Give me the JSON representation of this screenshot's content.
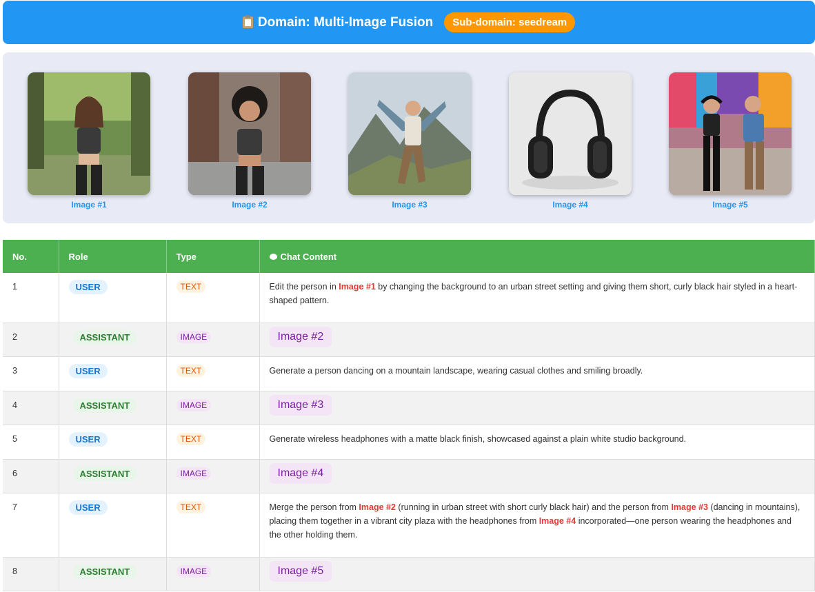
{
  "header": {
    "title": "Domain: Multi-Image Fusion",
    "subdomain": "Sub-domain: seedream"
  },
  "gallery": [
    {
      "label": "Image #1",
      "icon": "photo-woman-running-park"
    },
    {
      "label": "Image #2",
      "icon": "photo-woman-running-street"
    },
    {
      "label": "Image #3",
      "icon": "photo-man-dancing-mountains"
    },
    {
      "label": "Image #4",
      "icon": "photo-headphones"
    },
    {
      "label": "Image #5",
      "icon": "photo-city-plaza-fusion"
    }
  ],
  "table": {
    "headers": [
      "No.",
      "Role",
      "Type",
      "Chat Content"
    ],
    "rows": [
      {
        "no": "1",
        "role": "USER",
        "type": "TEXT",
        "parts": [
          "Edit the person in ",
          "Image #1",
          " by changing the background to an urban street setting and giving them short, curly black hair styled in a heart-shaped pattern."
        ]
      },
      {
        "no": "2",
        "role": "ASSISTANT",
        "type": "IMAGE",
        "image": "Image #2"
      },
      {
        "no": "3",
        "role": "USER",
        "type": "TEXT",
        "parts": [
          "Generate a person dancing on a mountain landscape, wearing casual clothes and smiling broadly."
        ]
      },
      {
        "no": "4",
        "role": "ASSISTANT",
        "type": "IMAGE",
        "image": "Image #3"
      },
      {
        "no": "5",
        "role": "USER",
        "type": "TEXT",
        "parts": [
          "Generate wireless headphones with a matte black finish, showcased against a plain white studio background."
        ]
      },
      {
        "no": "6",
        "role": "ASSISTANT",
        "type": "IMAGE",
        "image": "Image #4"
      },
      {
        "no": "7",
        "role": "USER",
        "type": "TEXT",
        "parts": [
          "Merge the person from ",
          "Image #2",
          " (running in urban street with short curly black hair) and the person from ",
          "Image #3",
          " (dancing in mountains), placing them together in a vibrant city plaza with the headphones from ",
          "Image #4",
          " incorporated—one person wearing the headphones and the other holding them."
        ]
      },
      {
        "no": "8",
        "role": "ASSISTANT",
        "type": "IMAGE",
        "image": "Image #5"
      }
    ]
  },
  "colors": {
    "header_bg": "#2196f3",
    "subdomain_badge": "#ff9800",
    "table_header": "#4caf50",
    "ref_red": "#e53935"
  }
}
